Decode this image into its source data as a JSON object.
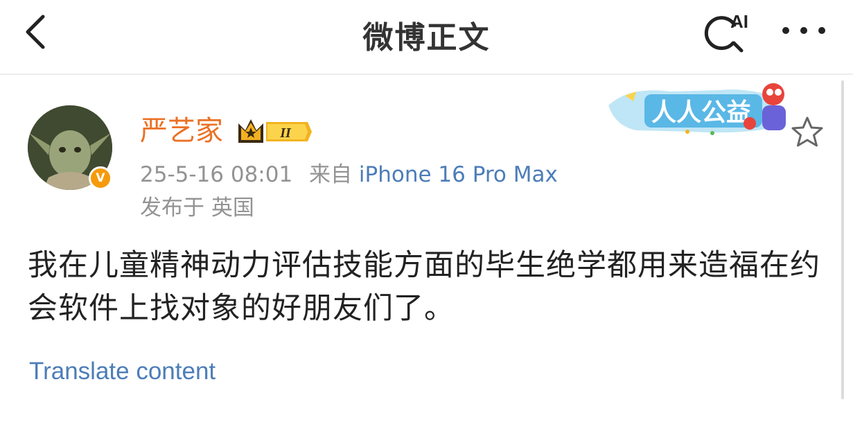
{
  "header": {
    "title": "微博正文",
    "ai_label": "AI"
  },
  "post": {
    "author": "严艺家",
    "member_badge": "II",
    "verified_badge": "V",
    "time": "25-5-16 08:01",
    "from_prefix": "来自",
    "device": "iPhone 16 Pro Max",
    "location": "发布于 英国",
    "banner_text": "人人公益",
    "content": "我在儿童精神动力评估技能方面的毕生绝学都用来造福在约会软件上找对象的好朋友们了。",
    "translate_label": "Translate content"
  },
  "icons": {
    "back": "chevron-left-icon",
    "ai_search": "ai-search-icon",
    "more": "more-dots-icon",
    "favorite": "star-outline-icon",
    "member": "crown-badge-icon"
  },
  "colors": {
    "username": "#eb7125",
    "link": "#4c7db8",
    "meta": "#939393",
    "verified": "#f59a0b"
  }
}
